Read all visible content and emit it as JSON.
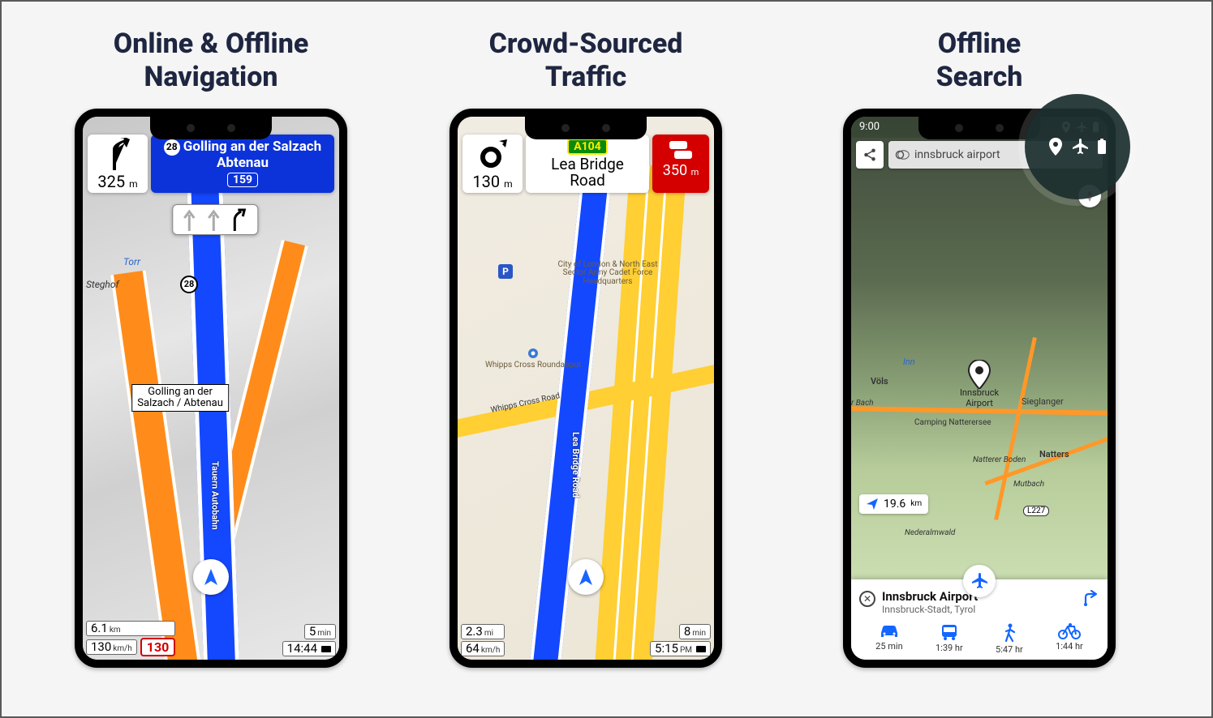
{
  "panels": [
    {
      "title_line1": "Online & Offline",
      "title_line2": "Navigation"
    },
    {
      "title_line1": "Crowd-Sourced",
      "title_line2": "Traffic"
    },
    {
      "title_line1": "Offline",
      "title_line2": "Search"
    }
  ],
  "nav1": {
    "maneuver_distance": "325",
    "maneuver_unit": "m",
    "ring": "28",
    "dest_line": "Golling an der Salzach",
    "dest_line2": "Abtenau",
    "exit_badge": "159",
    "map_sign_line1": "Golling an der",
    "map_sign_line2": "Salzach / Abtenau",
    "road_label": "Tauern Autobahn",
    "town_steghof": "Steghof",
    "town_torr": "Torr",
    "bottom": {
      "dist_total": "6.1",
      "dist_unit": "km",
      "speed": "130",
      "speed_unit": "km/h",
      "speed_limit": "130",
      "eta_min": "5",
      "eta_unit": "min",
      "clock": "14:44"
    }
  },
  "nav2": {
    "maneuver_distance": "130",
    "maneuver_unit": "m",
    "road_code": "A104",
    "road_name_line1": "Lea Bridge",
    "road_name_line2": "Road",
    "traffic_distance": "350",
    "traffic_unit": "m",
    "road_label": "Lea Bridge Road",
    "cross_label": "Whipps Cross Road",
    "roundabout_label": "Whipps Cross Roundabout",
    "poi1_line1": "City of London & North East",
    "poi1_line2": "Sector Army Cadet Force",
    "poi1_line3": "Headquarters",
    "poi_parking": "P",
    "bottom": {
      "dist_total": "2.3",
      "dist_unit": "mi",
      "speed": "64",
      "speed_unit": "km/h",
      "eta_min": "8",
      "eta_unit": "min",
      "clock": "5:15",
      "clock_suffix": "PM"
    }
  },
  "search": {
    "status_time": "9:00",
    "query": "innsbruck airport",
    "distance_value": "19.6",
    "distance_unit": "km",
    "result_title": "Innsbruck Airport",
    "result_sub": "Innsbruck-Stadt, Tyrol",
    "pin_label_line1": "Innsbruck",
    "pin_label_line2": "Airport",
    "towns": {
      "vols": "Völs",
      "sieglanger": "Sieglanger",
      "natters": "Natters",
      "camping": "Camping Natterersee",
      "natterer": "Natterer Boden",
      "mutbach": "Mutbach",
      "inn": "Inn",
      "raitiserbach": "r Bach",
      "nederalm": "Nederalmwald",
      "route": "L227"
    },
    "modes": [
      {
        "icon": "car",
        "time": "25 min"
      },
      {
        "icon": "bus",
        "time": "1:39 hr"
      },
      {
        "icon": "walk",
        "time": "5:47 hr"
      },
      {
        "icon": "bike",
        "time": "1:44 hr"
      }
    ]
  }
}
